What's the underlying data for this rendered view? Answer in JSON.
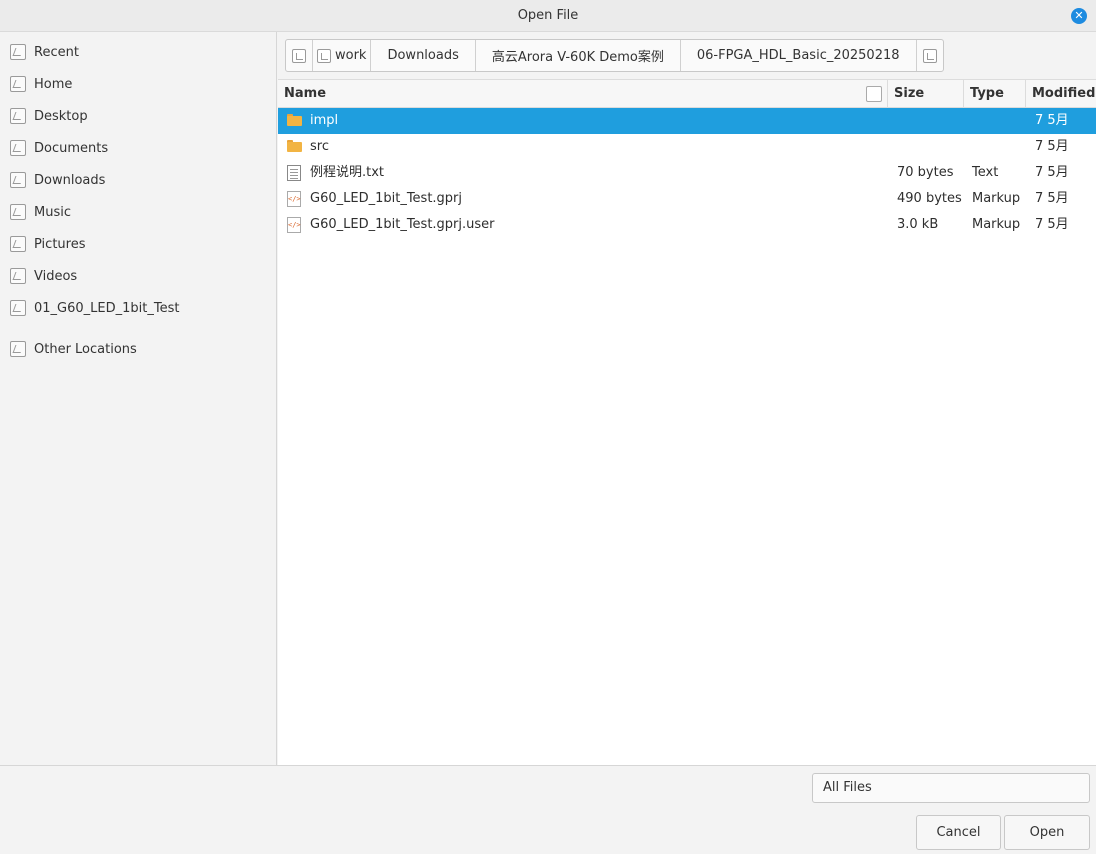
{
  "window": {
    "title": "Open File"
  },
  "sidebar": {
    "items": [
      {
        "label": "Recent"
      },
      {
        "label": "Home"
      },
      {
        "label": "Desktop"
      },
      {
        "label": "Documents"
      },
      {
        "label": "Downloads"
      },
      {
        "label": "Music"
      },
      {
        "label": "Pictures"
      },
      {
        "label": "Videos"
      },
      {
        "label": "01_G60_LED_1bit_Test"
      },
      {
        "label": "Other Locations"
      }
    ]
  },
  "pathbar": {
    "crumbs": [
      {
        "label": "work"
      },
      {
        "label": "Downloads"
      },
      {
        "label": "高云Arora V-60K Demo案例"
      },
      {
        "label": "06-FPGA_HDL_Basic_20250218"
      }
    ]
  },
  "filelist": {
    "columns": {
      "name": "Name",
      "size": "Size",
      "type": "Type",
      "modified": "Modified"
    },
    "rows": [
      {
        "icon": "folder-icon",
        "name": "impl",
        "size": "",
        "type": "",
        "modified": "7 5月",
        "selected": true
      },
      {
        "icon": "folder-icon",
        "name": "src",
        "size": "",
        "type": "",
        "modified": "7 5月",
        "selected": false
      },
      {
        "icon": "text-file-icon",
        "name": "例程说明.txt",
        "size": "70 bytes",
        "type": "Text",
        "modified": "7 5月",
        "selected": false
      },
      {
        "icon": "markup-file-icon",
        "name": "G60_LED_1bit_Test.gprj",
        "size": "490 bytes",
        "type": "Markup",
        "modified": "7 5月",
        "selected": false
      },
      {
        "icon": "markup-file-icon",
        "name": "G60_LED_1bit_Test.gprj.user",
        "size": "3.0 kB",
        "type": "Markup",
        "modified": "7 5月",
        "selected": false
      }
    ]
  },
  "footer": {
    "filter": "All Files",
    "cancel_label": "Cancel",
    "open_label": "Open"
  },
  "colors": {
    "selection": "#1f9ede",
    "folder": "#f2b443",
    "close_button": "#1d8be0"
  }
}
